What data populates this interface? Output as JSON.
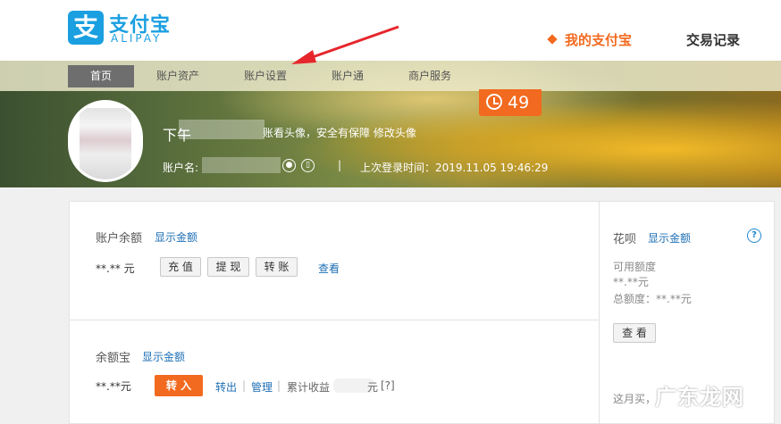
{
  "header": {
    "logo_icon": "支",
    "logo_cn": "支付宝",
    "logo_en": "ALIPAY",
    "nav_my": "我的支付宝",
    "nav_trade": "交易记录",
    "accent": "#f26a1f",
    "brand": "#1a9fe0"
  },
  "subnav": {
    "items": [
      "首页",
      "账户资产",
      "账户设置",
      "账户通",
      "商户服务"
    ]
  },
  "profile": {
    "greeting": "下午",
    "avatar_tip": "账看头像，安全有保障 修改头像",
    "account_label": "账户名:",
    "separator": "|",
    "last_login": "上次登录时间：2019.11.05 19:46:29",
    "badge_count": "49"
  },
  "balance": {
    "label": "账户余额",
    "show_link": "显示金额",
    "value": "**.** 元",
    "btn_recharge": "充 值",
    "btn_withdraw": "提 现",
    "btn_transfer": "转 账",
    "view_link": "查看"
  },
  "yuebao": {
    "label": "余额宝",
    "show_link": "显示金额",
    "value": "**.**元",
    "btn_in": "转 入",
    "link_out": "转出",
    "link_manage": "管理",
    "cum_income": "累计收益",
    "unit": "元",
    "help": "[?]",
    "bar": "|"
  },
  "huabei": {
    "label": "花呗",
    "show_link": "显示金额",
    "help_icon": "?",
    "available_label": "可用额度",
    "available_value": "**.**元",
    "total_label": "总额度：**.**元",
    "view_btn": "查 看",
    "month_text": "这月买，"
  },
  "watermark": "广东龙网"
}
